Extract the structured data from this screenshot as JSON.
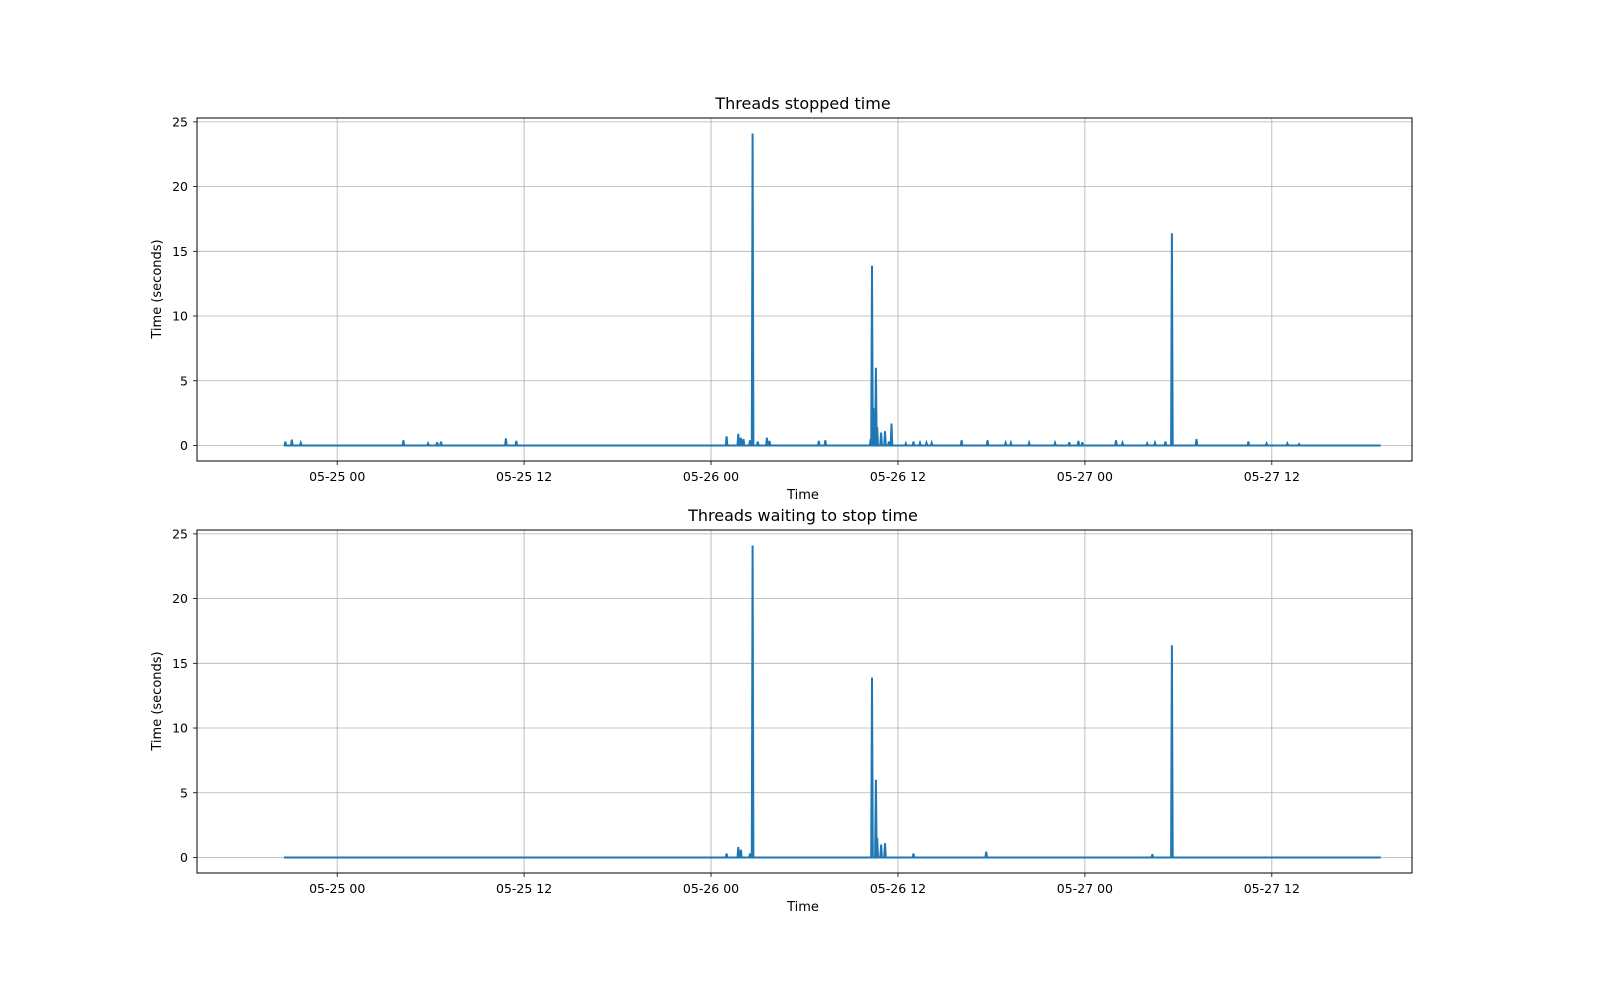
{
  "colors": {
    "line": "#1f77b4",
    "grid": "#b0b0b0",
    "frame": "#000000",
    "background": "#ffffff"
  },
  "chart_data": [
    {
      "type": "line",
      "title": "Threads stopped time",
      "xlabel": "Time",
      "ylabel": "Time (seconds)",
      "x_type": "datetime",
      "x_format": "MM-DD HH",
      "xlim": [
        "2024-05-24 15:00",
        "2024-05-27 21:00"
      ],
      "ylim": [
        -1.2,
        25.3
      ],
      "xticks": [
        "05-25 00",
        "05-25 12",
        "05-26 00",
        "05-26 12",
        "05-27 00",
        "05-27 12"
      ],
      "yticks": [
        0,
        5,
        10,
        15,
        20,
        25
      ],
      "grid": true,
      "series": [
        {
          "name": "",
          "points": [
            [
              "2024-05-24 20:40",
              0.3
            ],
            [
              "2024-05-24 21:05",
              0.45
            ],
            [
              "2024-05-24 21:40",
              0.2
            ],
            [
              "2024-05-25 04:15",
              0.4
            ],
            [
              "2024-05-25 05:50",
              0.15
            ],
            [
              "2024-05-25 06:25",
              0.25
            ],
            [
              "2024-05-25 06:40",
              0.3
            ],
            [
              "2024-05-25 10:50",
              0.55
            ],
            [
              "2024-05-25 11:30",
              0.35
            ],
            [
              "2024-05-26 01:00",
              0.7
            ],
            [
              "2024-05-26 01:45",
              0.9
            ],
            [
              "2024-05-26 01:55",
              0.6
            ],
            [
              "2024-05-26 02:05",
              0.5
            ],
            [
              "2024-05-26 02:30",
              0.4
            ],
            [
              "2024-05-26 02:40",
              24.1
            ],
            [
              "2024-05-26 03:00",
              0.3
            ],
            [
              "2024-05-26 03:35",
              0.6
            ],
            [
              "2024-05-26 03:45",
              0.35
            ],
            [
              "2024-05-26 06:55",
              0.35
            ],
            [
              "2024-05-26 07:20",
              0.4
            ],
            [
              "2024-05-26 10:15",
              0.5
            ],
            [
              "2024-05-26 10:20",
              13.9
            ],
            [
              "2024-05-26 10:25",
              2.9
            ],
            [
              "2024-05-26 10:35",
              6.0
            ],
            [
              "2024-05-26 10:40",
              1.4
            ],
            [
              "2024-05-26 10:55",
              1.0
            ],
            [
              "2024-05-26 11:10",
              1.1
            ],
            [
              "2024-05-26 11:25",
              0.3
            ],
            [
              "2024-05-26 11:35",
              1.7
            ],
            [
              "2024-05-26 12:30",
              0.15
            ],
            [
              "2024-05-26 13:00",
              0.3
            ],
            [
              "2024-05-26 13:25",
              0.2
            ],
            [
              "2024-05-26 13:50",
              0.2
            ],
            [
              "2024-05-26 14:10",
              0.2
            ],
            [
              "2024-05-26 16:05",
              0.4
            ],
            [
              "2024-05-26 17:45",
              0.4
            ],
            [
              "2024-05-26 18:55",
              0.2
            ],
            [
              "2024-05-26 19:15",
              0.2
            ],
            [
              "2024-05-26 20:25",
              0.2
            ],
            [
              "2024-05-26 22:05",
              0.2
            ],
            [
              "2024-05-26 23:00",
              0.25
            ],
            [
              "2024-05-26 23:35",
              0.35
            ],
            [
              "2024-05-26 23:50",
              0.25
            ],
            [
              "2024-05-27 02:00",
              0.4
            ],
            [
              "2024-05-27 02:25",
              0.2
            ],
            [
              "2024-05-27 04:00",
              0.15
            ],
            [
              "2024-05-27 04:30",
              0.2
            ],
            [
              "2024-05-27 05:10",
              0.3
            ],
            [
              "2024-05-27 05:35",
              16.4
            ],
            [
              "2024-05-27 07:10",
              0.5
            ],
            [
              "2024-05-27 10:30",
              0.3
            ],
            [
              "2024-05-27 11:40",
              0.15
            ],
            [
              "2024-05-27 13:00",
              0.15
            ],
            [
              "2024-05-27 13:45",
              0.1
            ]
          ]
        }
      ]
    },
    {
      "type": "line",
      "title": "Threads waiting to stop time",
      "xlabel": "Time",
      "ylabel": "Time (seconds)",
      "x_type": "datetime",
      "x_format": "MM-DD HH",
      "xlim": [
        "2024-05-24 15:00",
        "2024-05-27 21:00"
      ],
      "ylim": [
        -1.2,
        25.3
      ],
      "xticks": [
        "05-25 00",
        "05-25 12",
        "05-26 00",
        "05-26 12",
        "05-27 00",
        "05-27 12"
      ],
      "yticks": [
        0,
        5,
        10,
        15,
        20,
        25
      ],
      "grid": true,
      "series": [
        {
          "name": "",
          "points": [
            [
              "2024-05-26 01:00",
              0.3
            ],
            [
              "2024-05-26 01:45",
              0.8
            ],
            [
              "2024-05-26 01:55",
              0.6
            ],
            [
              "2024-05-26 02:30",
              0.3
            ],
            [
              "2024-05-26 02:40",
              24.1
            ],
            [
              "2024-05-26 10:20",
              13.9
            ],
            [
              "2024-05-26 10:35",
              6.0
            ],
            [
              "2024-05-26 10:40",
              1.5
            ],
            [
              "2024-05-26 10:55",
              1.0
            ],
            [
              "2024-05-26 11:10",
              1.1
            ],
            [
              "2024-05-26 13:00",
              0.3
            ],
            [
              "2024-05-26 17:40",
              0.45
            ],
            [
              "2024-05-27 04:20",
              0.25
            ],
            [
              "2024-05-27 05:35",
              16.4
            ]
          ]
        }
      ]
    }
  ]
}
